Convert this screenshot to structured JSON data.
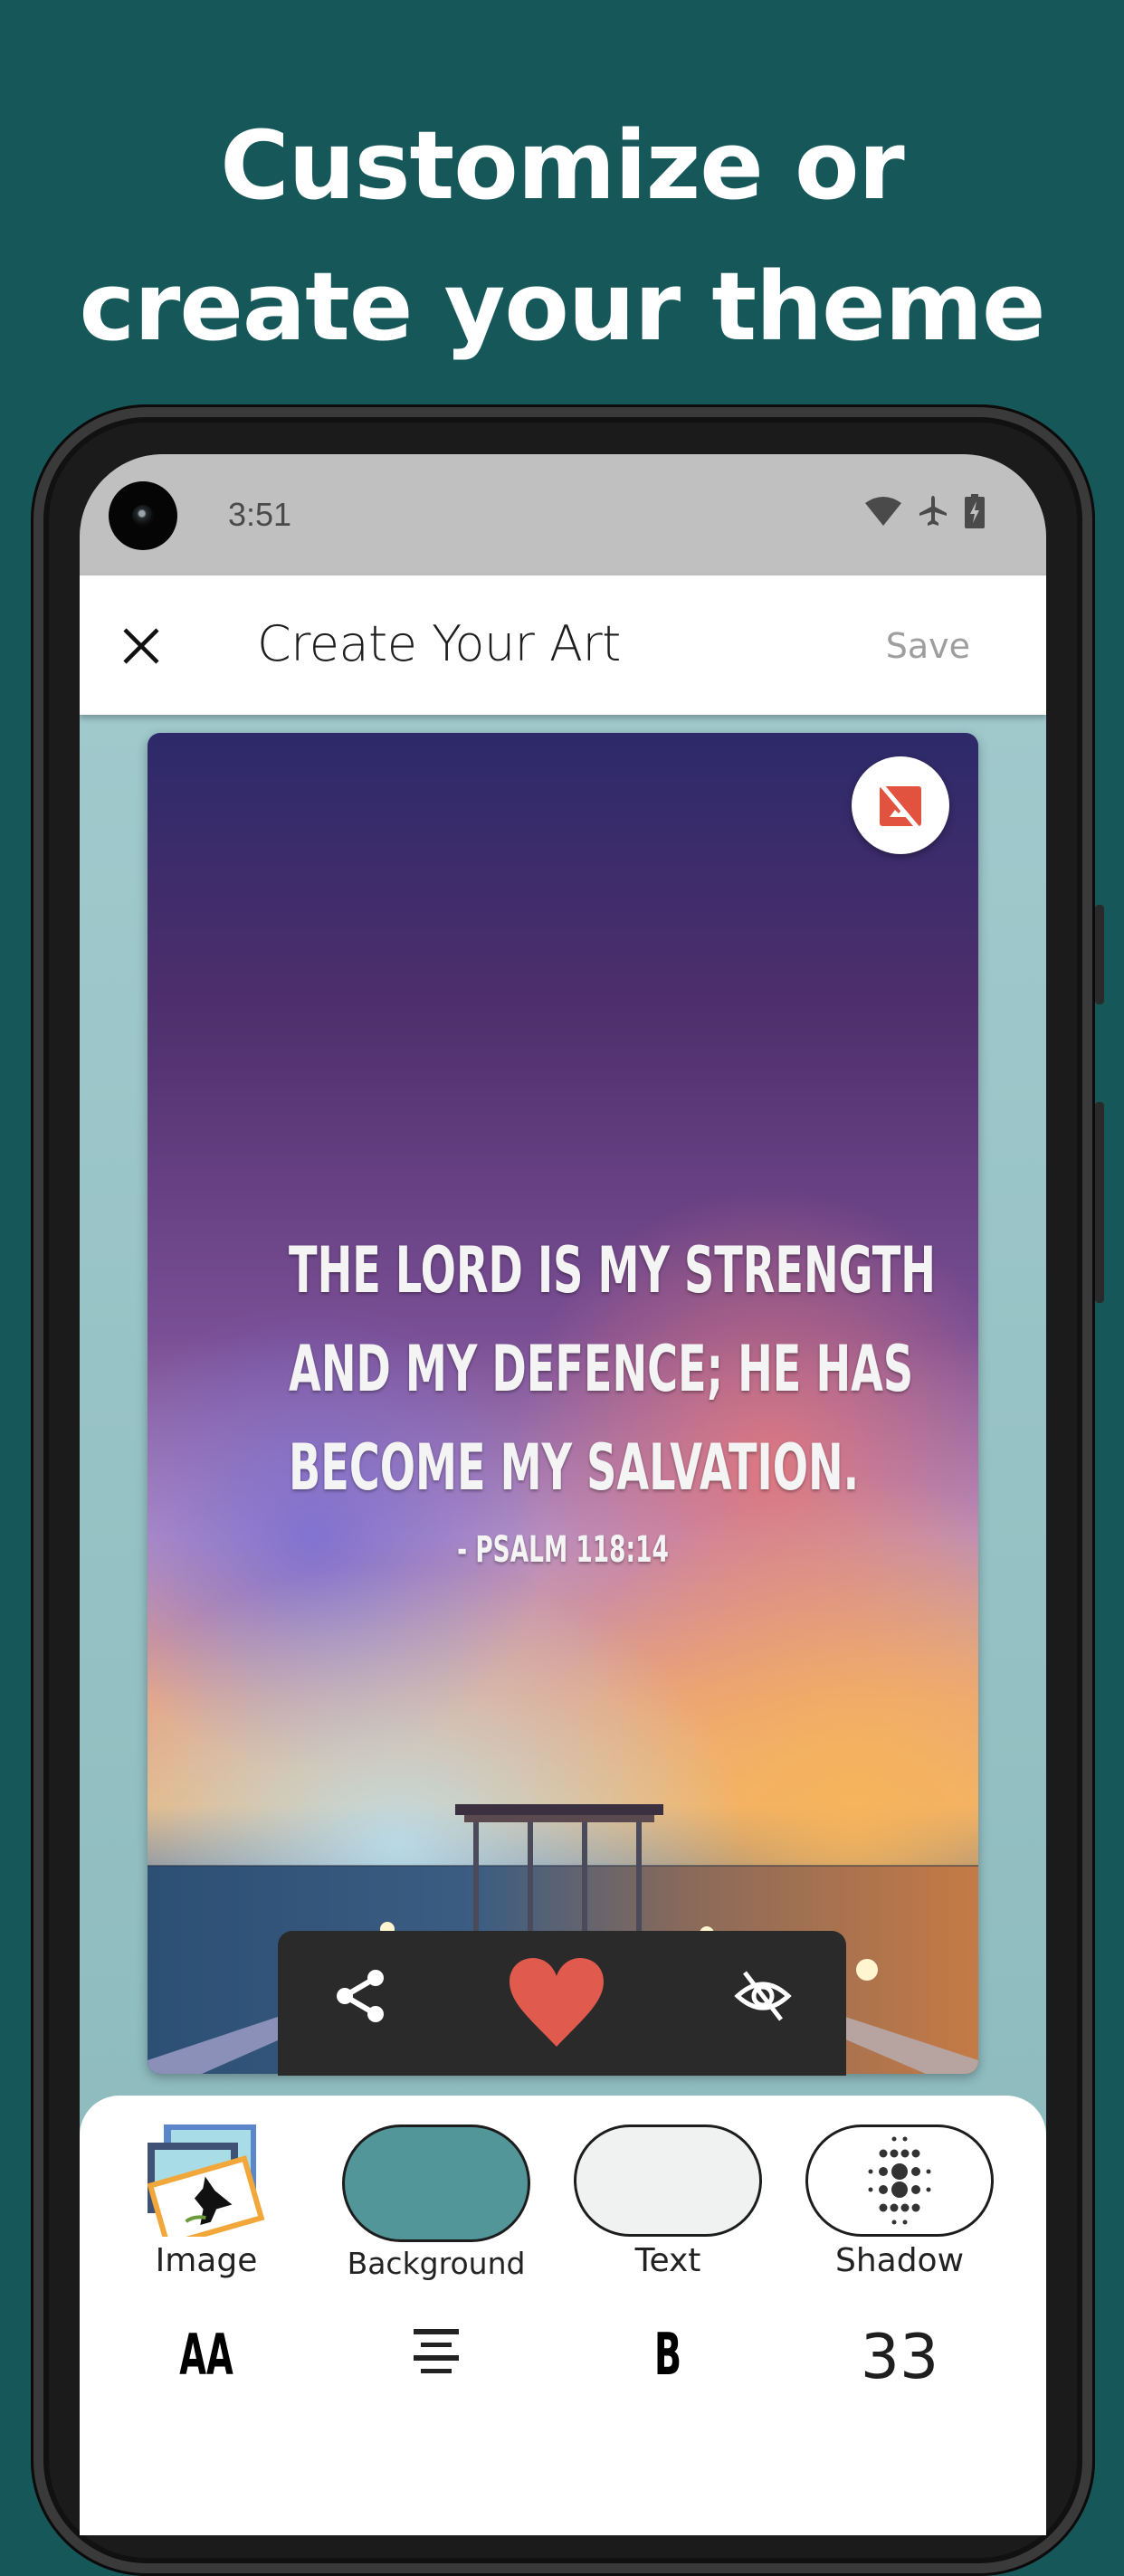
{
  "promo": {
    "headline_line1": "Customize or",
    "headline_line2": "create your theme",
    "background_color": "#16585a"
  },
  "status_bar": {
    "time": "3:51",
    "icons": [
      "wifi-icon",
      "airplane-mode-icon",
      "battery-charging-icon"
    ]
  },
  "app_bar": {
    "close_icon": "close-icon",
    "title": "Create Your Art",
    "save_label": "Save"
  },
  "art": {
    "verse_lines": [
      "THE LORD IS MY STRENGTH",
      "AND MY DEFENCE; HE HAS",
      "BECOME MY SALVATION."
    ],
    "reference": "- PSALM 118:14",
    "remove_image_icon": "hide-image-icon",
    "accent_color": "#e2533f"
  },
  "action_bar": {
    "share_icon": "share-icon",
    "favorite_icon": "heart-icon",
    "favorite_color": "#e05a4e",
    "hide_icon": "eye-off-icon"
  },
  "tools": {
    "items": [
      {
        "label": "Image",
        "icon": "image-gallery-icon"
      },
      {
        "label": "Background",
        "swatch_color": "#529699"
      },
      {
        "label": "Text",
        "swatch_color": "#f0f1f1"
      },
      {
        "label": "Shadow",
        "icon": "halftone-dots-icon"
      }
    ],
    "format": {
      "font_label": "AA",
      "align_icon": "align-center-icon",
      "bold_label": "B",
      "font_size": "33"
    }
  }
}
